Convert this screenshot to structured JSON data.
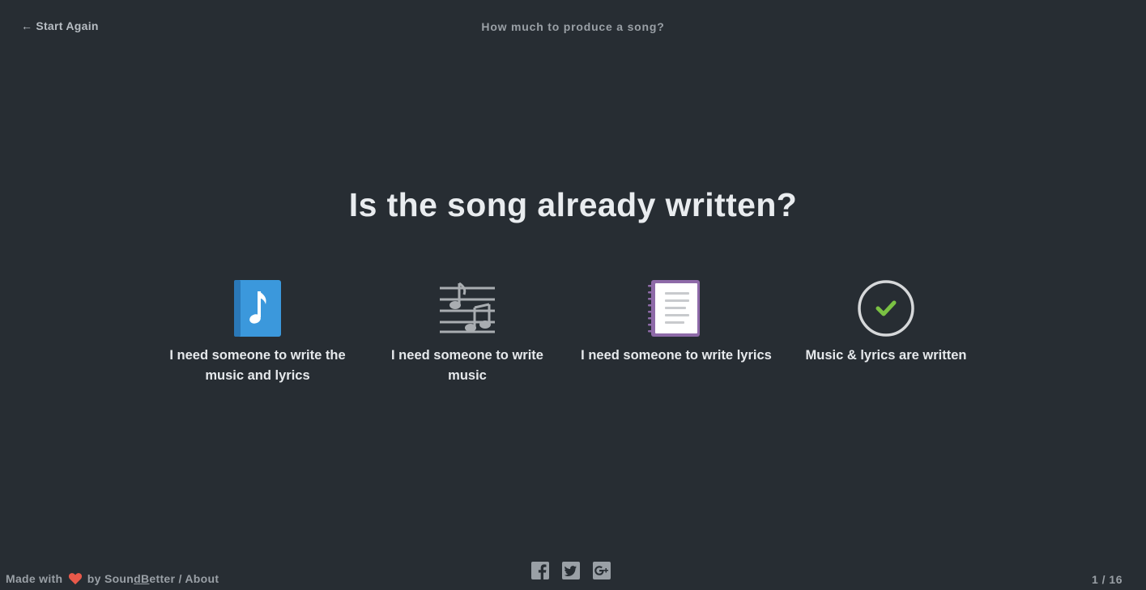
{
  "header": {
    "back_arrow": "←",
    "back_label": "Start Again",
    "title": "How much to produce a song?"
  },
  "question": "Is the song already written?",
  "options": [
    {
      "label": "I need someone to write the music and lyrics",
      "icon": "music-book-icon"
    },
    {
      "label": "I need someone to write music",
      "icon": "sheet-music-icon"
    },
    {
      "label": "I need someone to write lyrics",
      "icon": "notebook-icon"
    },
    {
      "label": "Music & lyrics are written",
      "icon": "checkmark-circle-icon"
    }
  ],
  "footer": {
    "made_with": "Made with",
    "by": "by",
    "brand_prefix": "Soun",
    "brand_d": "d",
    "brand_b": "B",
    "brand_suffix": "etter",
    "separator": "/",
    "about": "About",
    "progress": "1 / 16"
  },
  "social": [
    "facebook-icon",
    "twitter-icon",
    "google-plus-icon"
  ],
  "colors": {
    "background": "#272d33",
    "book_blue": "#3b98dc",
    "notebook_purple": "#8e6aa8",
    "check_green": "#7ac143",
    "heart": "#e8594a"
  }
}
